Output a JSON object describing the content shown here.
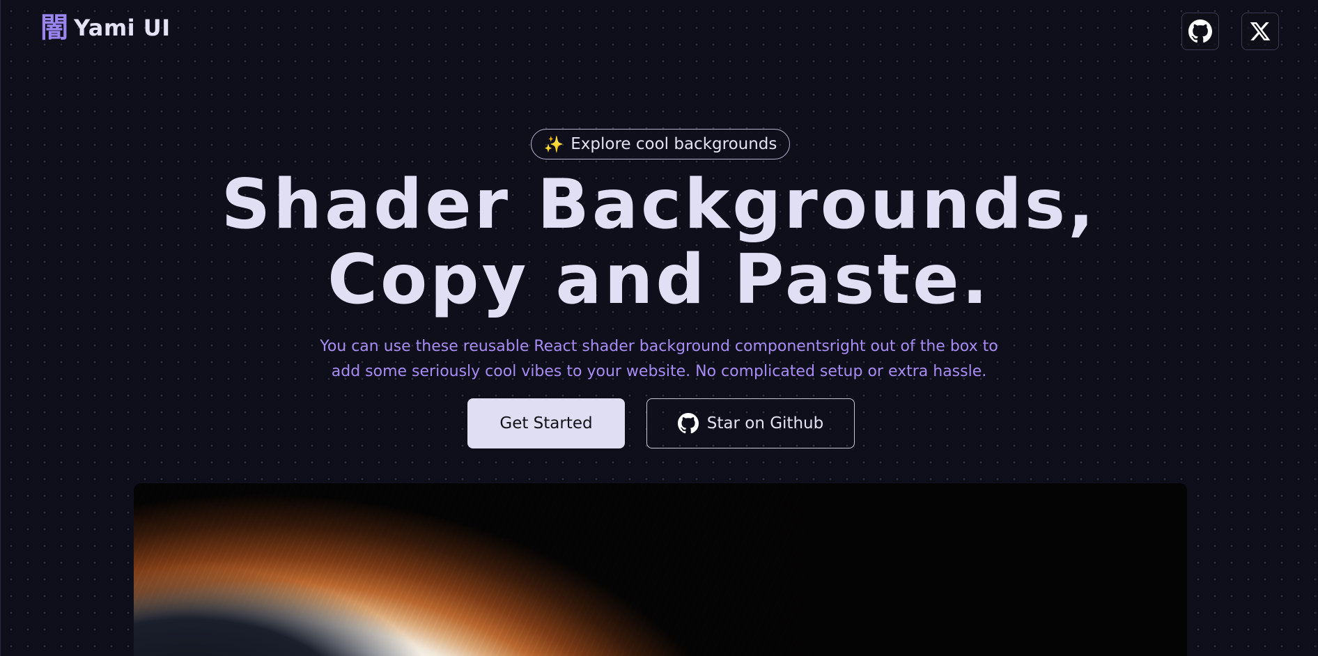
{
  "header": {
    "logo_mark": "闇",
    "brand_name": "Yami UI",
    "github_icon": "github-icon",
    "x_icon": "x-logo-icon"
  },
  "hero": {
    "badge_emoji": "✨",
    "badge_label": "Explore cool backgrounds",
    "headline_line1": "Shader Backgrounds,",
    "headline_line2": "Copy and Paste.",
    "subtitle_line1": "You can use these reusable React shader background componentsright out of the box to",
    "subtitle_line2": "add some seriously cool vibes to your website. No complicated setup or extra hassle.",
    "primary_button": "Get Started",
    "secondary_button": "Star on Github"
  },
  "colors": {
    "background": "#0f0f1b",
    "accent": "#a88cf5",
    "headline": "#e1dff3",
    "primary_button_bg": "#e0def3"
  }
}
